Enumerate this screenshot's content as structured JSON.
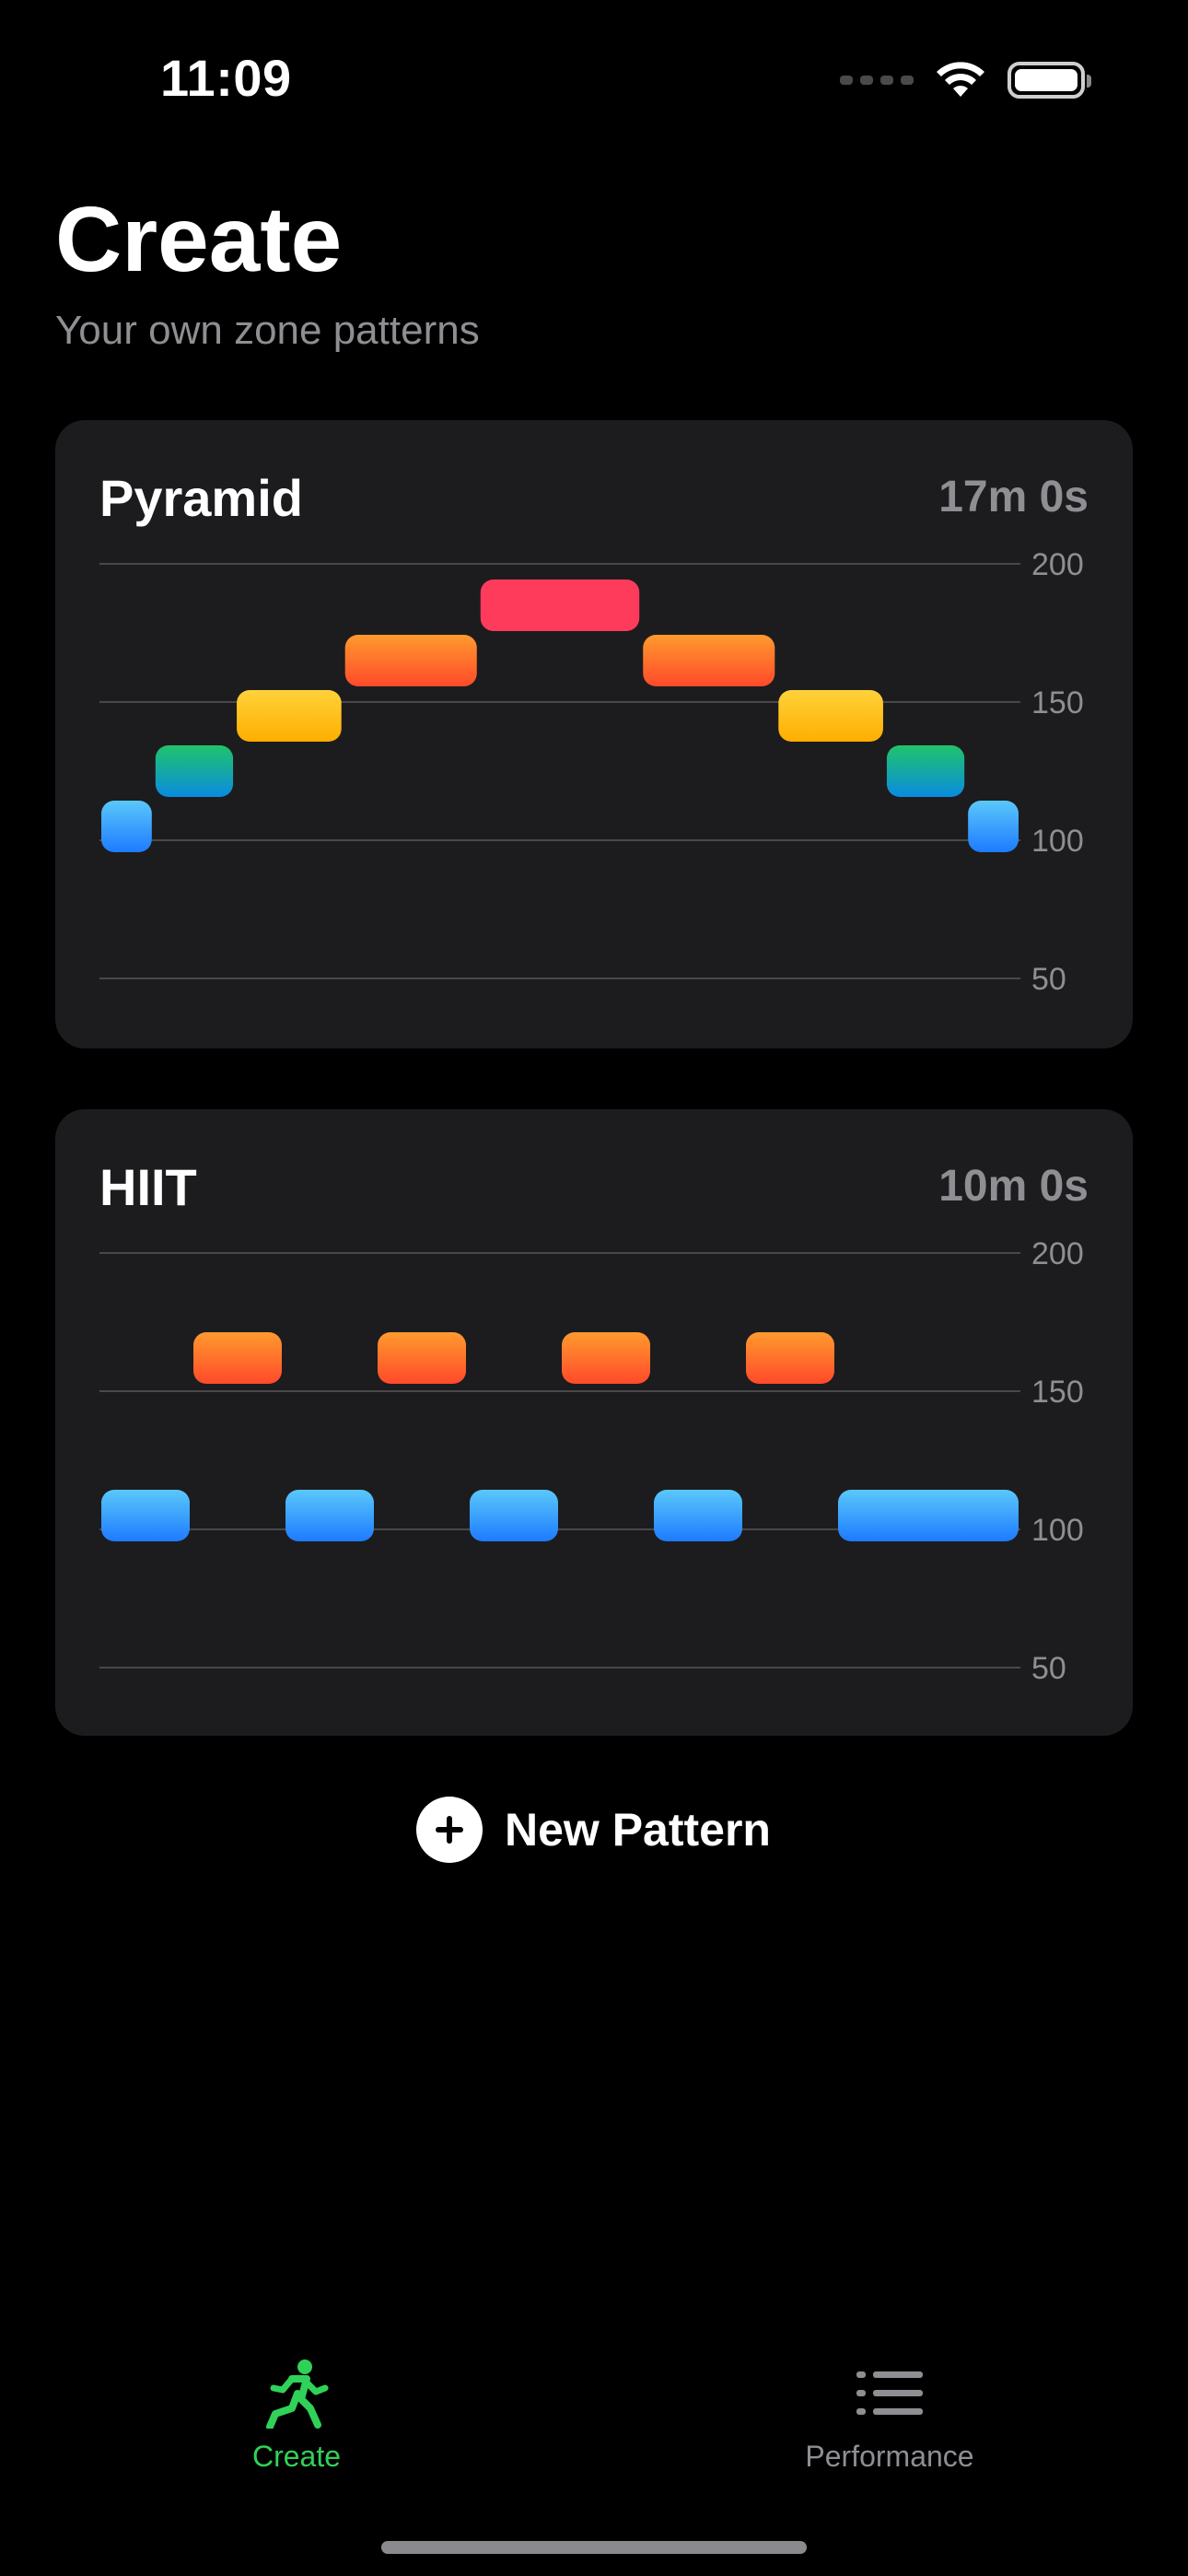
{
  "status_bar": {
    "time": "11:09"
  },
  "header": {
    "title": "Create",
    "subtitle": "Your own zone patterns"
  },
  "colors": {
    "zone_1": "#1e90ff",
    "zone_2": "#13b8a0",
    "zone_3": "#ffc107",
    "zone_4": "#ff7a2a",
    "zone_5": "#ff3b5c",
    "accent": "#30d158"
  },
  "patterns": [
    {
      "name": "Pyramid",
      "duration": "17m 0s",
      "y_ticks": [
        "200",
        "150",
        "100",
        "50"
      ],
      "chart_data": {
        "type": "bar",
        "y_axis": {
          "ticks": [
            200,
            150,
            100,
            50
          ],
          "range": [
            50,
            200
          ]
        },
        "segments": [
          {
            "zone": 1,
            "bpm": 105,
            "weight": 1
          },
          {
            "zone": 2,
            "bpm": 125,
            "weight": 1.5
          },
          {
            "zone": 3,
            "bpm": 145,
            "weight": 2
          },
          {
            "zone": 4,
            "bpm": 165,
            "weight": 2.5
          },
          {
            "zone": 5,
            "bpm": 185,
            "weight": 3
          },
          {
            "zone": 4,
            "bpm": 165,
            "weight": 2.5
          },
          {
            "zone": 3,
            "bpm": 145,
            "weight": 2
          },
          {
            "zone": 2,
            "bpm": 125,
            "weight": 1.5
          },
          {
            "zone": 1,
            "bpm": 105,
            "weight": 1
          }
        ]
      }
    },
    {
      "name": "HIIT",
      "duration": "10m 0s",
      "y_ticks": [
        "200",
        "150",
        "100",
        "50"
      ],
      "chart_data": {
        "type": "bar",
        "y_axis": {
          "ticks": [
            200,
            150,
            100,
            50
          ],
          "range": [
            50,
            200
          ]
        },
        "segments": [
          {
            "zone": 1,
            "bpm": 105,
            "weight": 1
          },
          {
            "zone": 4,
            "bpm": 162,
            "weight": 1
          },
          {
            "zone": 1,
            "bpm": 105,
            "weight": 1
          },
          {
            "zone": 4,
            "bpm": 162,
            "weight": 1
          },
          {
            "zone": 1,
            "bpm": 105,
            "weight": 1
          },
          {
            "zone": 4,
            "bpm": 162,
            "weight": 1
          },
          {
            "zone": 1,
            "bpm": 105,
            "weight": 1
          },
          {
            "zone": 4,
            "bpm": 162,
            "weight": 1
          },
          {
            "zone": 1,
            "bpm": 105,
            "weight": 2
          }
        ]
      }
    }
  ],
  "new_pattern": {
    "label": "New Pattern",
    "icon": "plus-circle-icon"
  },
  "tab_bar": {
    "tabs": [
      {
        "label": "Create",
        "icon": "running-figure-icon",
        "selected": true
      },
      {
        "label": "Performance",
        "icon": "list-icon",
        "selected": false
      }
    ]
  }
}
